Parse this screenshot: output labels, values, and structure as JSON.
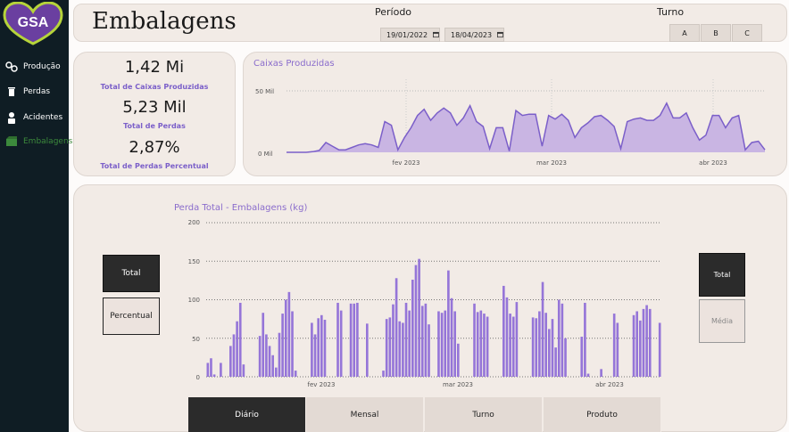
{
  "sidebar": {
    "logo_text": "GSA",
    "items": [
      {
        "label": "Produção",
        "icon": "gears-icon",
        "active": false
      },
      {
        "label": "Perdas",
        "icon": "trash-icon",
        "active": false
      },
      {
        "label": "Acidentes",
        "icon": "worker-icon",
        "active": false
      },
      {
        "label": "Embalagens",
        "icon": "box-icon",
        "active": true
      }
    ]
  },
  "header": {
    "title": "Embalagens",
    "period_label": "Período",
    "date_start": "19/01/2022",
    "date_end": "18/04/2023",
    "shift_label": "Turno",
    "shifts": [
      "A",
      "B",
      "C"
    ]
  },
  "kpis": [
    {
      "value": "1,42 Mi",
      "label": "Total de Caixas Produzidas"
    },
    {
      "value": "5,23 Mil",
      "label": "Total de Perdas"
    },
    {
      "value": "2,87%",
      "label": "Total de Perdas Percentual"
    }
  ],
  "colors": {
    "accent": "#7b5fc9",
    "bar": "#9575d8",
    "area_fill": "#c9b5e3",
    "dark": "#2b2b2b",
    "panel": "#f2ebe6"
  },
  "chart_data": [
    {
      "type": "area",
      "title": "Caixas Produzidas",
      "y_ticks": [
        "50 Mil",
        "0 Mil"
      ],
      "ylim": [
        0,
        50000
      ],
      "x_ticks": [
        "fev 2023",
        "mar 2023",
        "abr 2023"
      ],
      "grid": true,
      "x": [
        "2023-01-19",
        "2023-01-20",
        "2023-01-21",
        "2023-01-22",
        "2023-01-23",
        "2023-01-24",
        "2023-01-25",
        "2023-01-26",
        "2023-01-27",
        "2023-01-28",
        "2023-01-29",
        "2023-01-30",
        "2023-01-31",
        "2023-02-01",
        "2023-02-02",
        "2023-02-03",
        "2023-02-04",
        "2023-02-05",
        "2023-02-06",
        "2023-02-07",
        "2023-02-08",
        "2023-02-09",
        "2023-02-10",
        "2023-02-11",
        "2023-02-12",
        "2023-02-13",
        "2023-02-14",
        "2023-02-15",
        "2023-02-16",
        "2023-02-17",
        "2023-02-18",
        "2023-02-19",
        "2023-02-20",
        "2023-02-21",
        "2023-02-22",
        "2023-02-23",
        "2023-02-24",
        "2023-02-25",
        "2023-02-26",
        "2023-02-27",
        "2023-02-28",
        "2023-03-01",
        "2023-03-02",
        "2023-03-03",
        "2023-03-04",
        "2023-03-05",
        "2023-03-06",
        "2023-03-07",
        "2023-03-08",
        "2023-03-09",
        "2023-03-10",
        "2023-03-11",
        "2023-03-12",
        "2023-03-13",
        "2023-03-14",
        "2023-03-15",
        "2023-03-16",
        "2023-03-17",
        "2023-03-18",
        "2023-03-19",
        "2023-03-20",
        "2023-03-21",
        "2023-03-22",
        "2023-03-23",
        "2023-03-24",
        "2023-03-25",
        "2023-03-26",
        "2023-03-27",
        "2023-03-28",
        "2023-03-29",
        "2023-03-30",
        "2023-03-31",
        "2023-04-01",
        "2023-04-02",
        "2023-04-03",
        "2023-04-04",
        "2023-04-05",
        "2023-04-06",
        "2023-04-07",
        "2023-04-08",
        "2023-04-09",
        "2023-04-10",
        "2023-04-11",
        "2023-04-12",
        "2023-04-13",
        "2023-04-14",
        "2023-04-15",
        "2023-04-16",
        "2023-04-17",
        "2023-04-18"
      ],
      "values": [
        0,
        0,
        0,
        0,
        500,
        1500,
        8000,
        5000,
        2000,
        2000,
        4000,
        6000,
        7000,
        6000,
        4000,
        25000,
        22000,
        2000,
        12000,
        20000,
        30000,
        35000,
        26000,
        32000,
        36000,
        32000,
        22000,
        28000,
        38000,
        25000,
        21000,
        3000,
        20000,
        20000,
        1000,
        34000,
        30000,
        31000,
        31000,
        5000,
        30000,
        27000,
        31000,
        26000,
        12000,
        20000,
        24000,
        29000,
        30000,
        26000,
        21000,
        3000,
        25000,
        27000,
        28000,
        26000,
        26000,
        30000,
        40000,
        28000,
        28000,
        32000,
        20000,
        10000,
        14000,
        30000,
        30000,
        20000,
        28000,
        30000,
        2000,
        8000,
        9000,
        2000
      ],
      "x_start_date": "2023-01-19"
    },
    {
      "type": "bar",
      "title": "Perda Total - Embalagens (kg)",
      "y_ticks": [
        "200",
        "150",
        "100",
        "50",
        "0"
      ],
      "ylim": [
        0,
        200
      ],
      "x_ticks": [
        "fev 2023",
        "mar 2023",
        "abr 2023"
      ],
      "grid": true,
      "values": [
        18,
        24,
        3,
        0,
        18,
        0,
        0,
        40,
        55,
        72,
        96,
        16,
        0,
        0,
        0,
        0,
        53,
        83,
        55,
        40,
        28,
        12,
        57,
        82,
        100,
        110,
        85,
        8,
        0,
        0,
        0,
        0,
        70,
        55,
        76,
        80,
        74,
        0,
        0,
        0,
        96,
        86,
        0,
        0,
        95,
        95,
        96,
        0,
        0,
        69,
        0,
        0,
        0,
        0,
        8,
        75,
        77,
        94,
        128,
        72,
        70,
        96,
        86,
        126,
        145,
        153,
        92,
        95,
        68,
        0,
        0,
        85,
        83,
        86,
        138,
        102,
        85,
        43,
        0,
        0,
        0,
        0,
        95,
        84,
        86,
        82,
        78,
        0,
        0,
        0,
        0,
        118,
        103,
        82,
        78,
        97,
        0,
        0,
        0,
        0,
        77,
        76,
        85,
        123,
        83,
        62,
        75,
        38,
        100,
        95,
        50,
        0,
        0,
        0,
        0,
        52,
        96,
        4,
        0,
        0,
        0,
        10,
        0,
        0,
        0,
        82,
        70,
        0,
        0,
        0,
        0,
        80,
        85,
        73,
        88,
        93,
        88,
        0,
        0,
        70
      ],
      "x_start_date": "2023-01-19"
    }
  ],
  "toggles_left": [
    "Total",
    "Percentual"
  ],
  "toggles_right": [
    "Total",
    "Média"
  ],
  "tabs": [
    "Diário",
    "Mensal",
    "Turno",
    "Produto"
  ]
}
